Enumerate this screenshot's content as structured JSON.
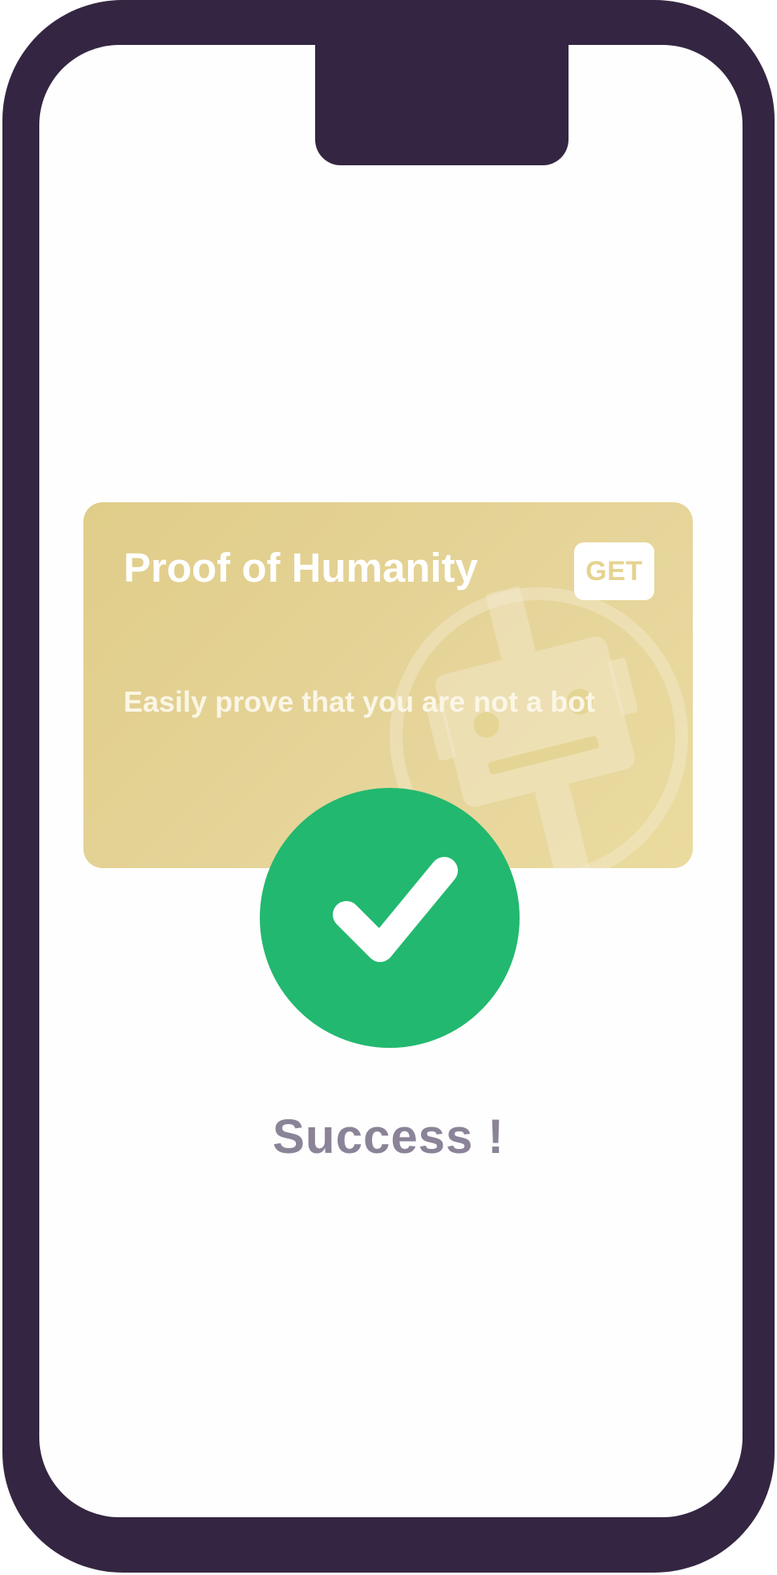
{
  "colors": {
    "phone_frame": "#342642",
    "card_background": "#e3d18f",
    "success_green": "#22b86f",
    "success_text": "#8b8397"
  },
  "card": {
    "title": "Proof of Humanity",
    "subtitle": "Easily prove that you are not a bot",
    "button_label": "GET",
    "watermark_icon": "robot-icon"
  },
  "status": {
    "icon": "checkmark-icon",
    "message": "Success !"
  }
}
